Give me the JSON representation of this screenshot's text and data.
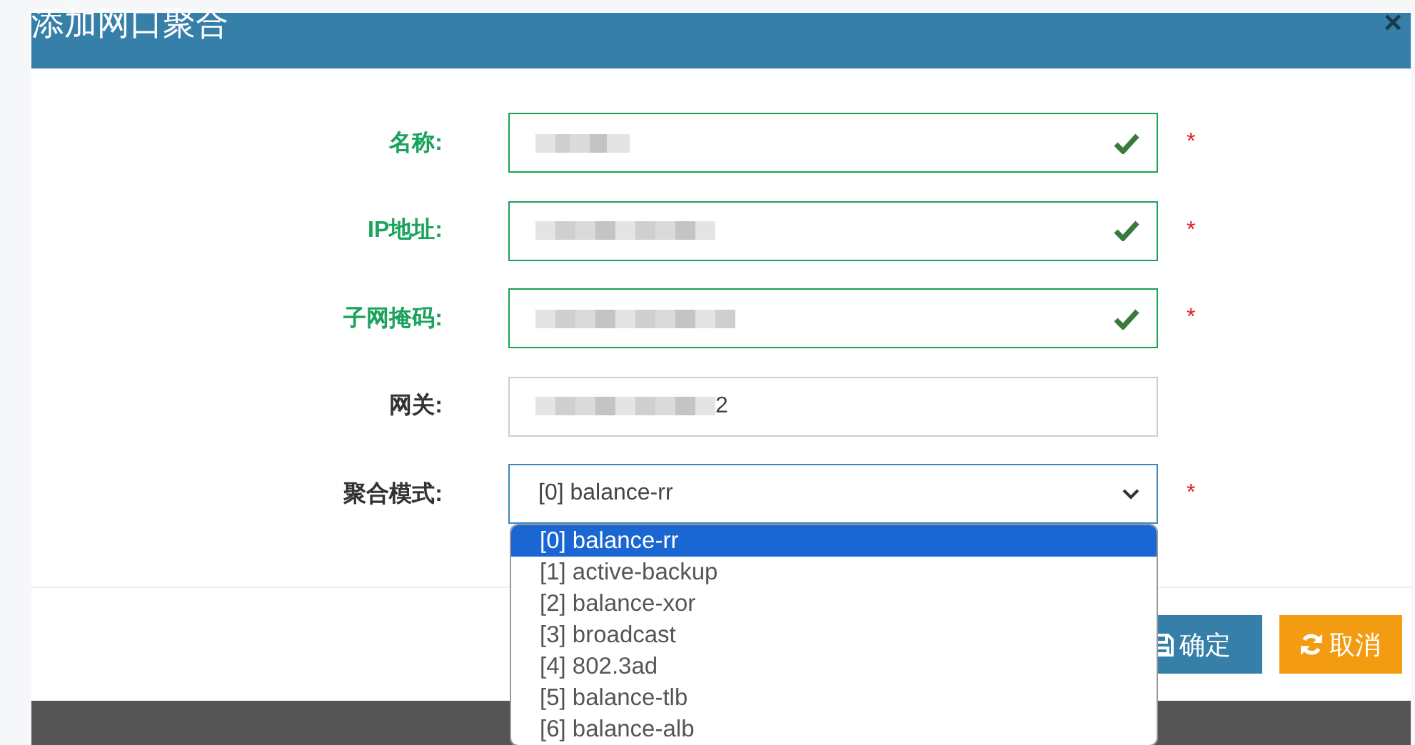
{
  "dialog": {
    "title": "添加网口聚合",
    "close": "×"
  },
  "fields": [
    {
      "label": "名称:",
      "kind": "text",
      "valid": true,
      "required": "*",
      "value_blurred": true
    },
    {
      "label": "IP地址:",
      "kind": "text",
      "valid": true,
      "required": "*",
      "value_blurred": true
    },
    {
      "label": "子网掩码:",
      "kind": "text",
      "valid": true,
      "required": "*",
      "value_blurred": true
    },
    {
      "label": "网关:",
      "kind": "text",
      "valid": false,
      "value_blurred": true,
      "value": "2"
    },
    {
      "label": "聚合模式:",
      "kind": "select",
      "valid": false,
      "required": "*",
      "value": "[0] balance-rr",
      "expanded": true,
      "options": [
        {
          "label": "[0] balance-rr",
          "selected": true
        },
        {
          "label": "[1] active-backup",
          "selected": false
        },
        {
          "label": "[2] balance-xor",
          "selected": false
        },
        {
          "label": "[3] broadcast",
          "selected": false
        },
        {
          "label": "[4] 802.3ad",
          "selected": false
        },
        {
          "label": "[5] balance-tlb",
          "selected": false
        },
        {
          "label": "[6] balance-alb",
          "selected": false
        }
      ]
    }
  ],
  "buttons": [
    {
      "label": "确定",
      "kind": "primary"
    },
    {
      "label": "取消",
      "kind": "warning"
    }
  ]
}
